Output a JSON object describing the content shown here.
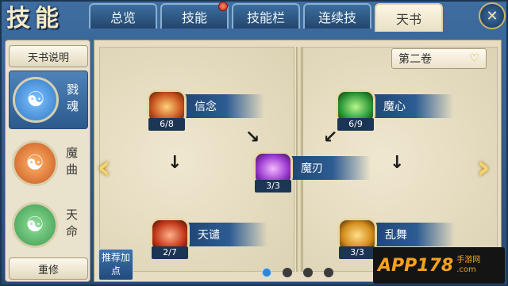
{
  "header": {
    "title": "技能",
    "tabs": [
      "总览",
      "技能",
      "技能栏",
      "连续技",
      "天书"
    ],
    "active_tab": "天书"
  },
  "left_panel": {
    "info_button": "天书说明",
    "books": [
      {
        "name": "戮魂",
        "color": "#2f78c4",
        "icon": "blue-beast-icon",
        "selected": true
      },
      {
        "name": "魔曲",
        "color": "#c8581e",
        "icon": "orange-beast-icon",
        "selected": false
      },
      {
        "name": "天命",
        "color": "#3d9a4c",
        "icon": "green-beast-icon",
        "selected": false
      }
    ],
    "reset_button": "重修"
  },
  "book": {
    "volume": "第二卷",
    "skills": [
      {
        "name": "信念",
        "count": "6/8",
        "color": "#c9541f"
      },
      {
        "name": "魔心",
        "count": "6/9",
        "color": "#2f9a3a"
      },
      {
        "name": "魔刃",
        "count": "3/3",
        "color": "#9a3ad0"
      },
      {
        "name": "天谴",
        "count": "2/7",
        "color": "#c23a1c"
      },
      {
        "name": "乱舞",
        "count": "3/3",
        "color": "#d28a1a"
      }
    ]
  },
  "recommend_button": "推荐加点",
  "pagination": {
    "total": 4,
    "active": 1
  },
  "watermark": {
    "main": "APP178",
    "sub_top": "手游网",
    "sub_bottom": ".com"
  }
}
